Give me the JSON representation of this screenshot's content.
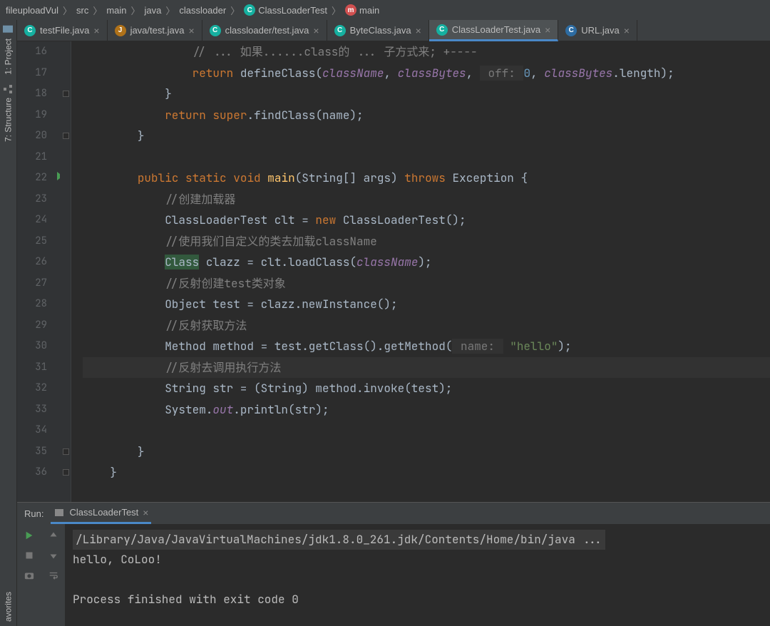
{
  "breadcrumbs": [
    "fileuploadVul",
    "src",
    "main",
    "java",
    "classloader",
    "ClassLoaderTest",
    "main"
  ],
  "side": {
    "project": "1: Project",
    "structure": "7: Structure",
    "favorites": "avorites"
  },
  "tabs": [
    {
      "label": "testFile.java",
      "active": false,
      "icon": "c"
    },
    {
      "label": "java/test.java",
      "active": false,
      "icon": "j"
    },
    {
      "label": "classloader/test.java",
      "active": false,
      "icon": "c"
    },
    {
      "label": "ByteClass.java",
      "active": false,
      "icon": "c"
    },
    {
      "label": "ClassLoaderTest.java",
      "active": true,
      "icon": "c"
    },
    {
      "label": "URL.java",
      "active": false,
      "icon": "cblue"
    }
  ],
  "gutter_start": 16,
  "code": {
    "lines": [
      {
        "n": 16,
        "t": [
          {
            "pre": "                "
          },
          {
            "c": "comment",
            "v": "// ... 如果......class的 ... 子方式来; +----"
          }
        ]
      },
      {
        "n": 17,
        "t": [
          {
            "pre": "                "
          },
          {
            "c": "kw",
            "v": "return"
          },
          {
            "v": " defineClass("
          },
          {
            "c": "ident",
            "v": "className"
          },
          {
            "v": ", "
          },
          {
            "c": "ident",
            "v": "classBytes"
          },
          {
            "v": ", "
          },
          {
            "c": "param-hint",
            "v": " off: "
          },
          {
            "c": "num",
            "v": "0"
          },
          {
            "v": ", "
          },
          {
            "c": "ident",
            "v": "classBytes"
          },
          {
            "v": ".length);"
          }
        ]
      },
      {
        "n": 18,
        "t": [
          {
            "pre": "            "
          },
          {
            "v": "}"
          }
        ]
      },
      {
        "n": 19,
        "t": [
          {
            "pre": "            "
          },
          {
            "c": "kw",
            "v": "return"
          },
          {
            "v": " "
          },
          {
            "c": "kw",
            "v": "super"
          },
          {
            "v": ".findClass(name);"
          }
        ]
      },
      {
        "n": 20,
        "t": [
          {
            "pre": "        "
          },
          {
            "v": "}"
          }
        ]
      },
      {
        "n": 21,
        "t": []
      },
      {
        "n": 22,
        "t": [
          {
            "pre": "        "
          },
          {
            "c": "kw",
            "v": "public"
          },
          {
            "v": " "
          },
          {
            "c": "kw",
            "v": "static"
          },
          {
            "v": " "
          },
          {
            "c": "kw",
            "v": "void"
          },
          {
            "v": " "
          },
          {
            "c": "method",
            "v": "main",
            "style": "color:#ffc66d"
          },
          {
            "v": "(String[] args) "
          },
          {
            "c": "kw",
            "v": "throws"
          },
          {
            "v": " Exception {"
          }
        ]
      },
      {
        "n": 23,
        "t": [
          {
            "pre": "            "
          },
          {
            "c": "comment",
            "v": "//创建加载器"
          }
        ]
      },
      {
        "n": 24,
        "t": [
          {
            "pre": "            "
          },
          {
            "v": "ClassLoaderTest clt = "
          },
          {
            "c": "kw",
            "v": "new"
          },
          {
            "v": " ClassLoaderTest();"
          }
        ]
      },
      {
        "n": 25,
        "t": [
          {
            "pre": "            "
          },
          {
            "c": "comment",
            "v": "//使用我们自定义的类去加载className"
          }
        ]
      },
      {
        "n": 26,
        "t": [
          {
            "pre": "            "
          },
          {
            "c": "hl",
            "v": "Class"
          },
          {
            "v": " clazz = clt.loadClass("
          },
          {
            "c": "ident",
            "v": "className"
          },
          {
            "v": ");"
          }
        ]
      },
      {
        "n": 27,
        "t": [
          {
            "pre": "            "
          },
          {
            "c": "comment",
            "v": "//反射创建test类对象"
          }
        ]
      },
      {
        "n": 28,
        "t": [
          {
            "pre": "            "
          },
          {
            "v": "Object test = clazz.newInstance();"
          }
        ]
      },
      {
        "n": 29,
        "t": [
          {
            "pre": "            "
          },
          {
            "c": "comment",
            "v": "//反射获取方法"
          }
        ]
      },
      {
        "n": 30,
        "t": [
          {
            "pre": "            "
          },
          {
            "v": "Method method = test.getClass().getMethod("
          },
          {
            "c": "param-hint",
            "v": " name: "
          },
          {
            "v": " "
          },
          {
            "c": "str",
            "v": "\"hello\""
          },
          {
            "v": ");"
          }
        ]
      },
      {
        "n": 31,
        "caret": true,
        "t": [
          {
            "pre": "            "
          },
          {
            "c": "comment",
            "v": "//反射去调用执行方法"
          }
        ]
      },
      {
        "n": 32,
        "t": [
          {
            "pre": "            "
          },
          {
            "v": "String str = (String) method.invoke(test);"
          }
        ]
      },
      {
        "n": 33,
        "t": [
          {
            "pre": "            "
          },
          {
            "v": "System."
          },
          {
            "c": "ident",
            "v": "out"
          },
          {
            "v": ".println(str);"
          }
        ]
      },
      {
        "n": 34,
        "t": []
      },
      {
        "n": 35,
        "t": [
          {
            "pre": "        "
          },
          {
            "v": "}"
          }
        ]
      },
      {
        "n": 36,
        "t": [
          {
            "pre": "    "
          },
          {
            "v": "}"
          }
        ]
      }
    ]
  },
  "run": {
    "title": "Run:",
    "tab": "ClassLoaderTest",
    "console": [
      {
        "type": "cmd",
        "v": "/Library/Java/JavaVirtualMachines/jdk1.8.0_261.jdk/Contents/Home/bin/java ..."
      },
      {
        "type": "out",
        "v": "hello, CoLoo!"
      },
      {
        "type": "blank",
        "v": ""
      },
      {
        "type": "out",
        "v": "Process finished with exit code 0"
      }
    ]
  }
}
